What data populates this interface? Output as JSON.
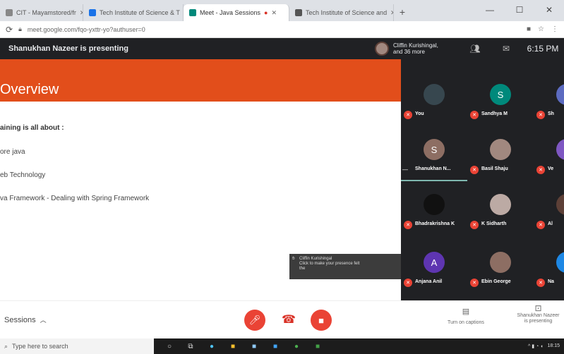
{
  "browser": {
    "tabs": [
      {
        "label": "CIT - Mayamstored/fr",
        "color": "#888",
        "active": false
      },
      {
        "label": "Tech Institute of Science & T",
        "color": "#1a73e8",
        "active": false
      },
      {
        "label": "Meet - Java Sessions",
        "color": "#00897b",
        "active": true
      },
      {
        "label": "Tech Institute of Science and",
        "color": "#555",
        "active": false
      }
    ],
    "address": "meet.google.com/fqo-yxttr-yo?authuser=0",
    "window_controls": [
      "—",
      "☐",
      "✕"
    ]
  },
  "meet": {
    "presenting_text": "Shanukhan Nazeer is presenting",
    "others_text_line1": "Cliffin Kurishingal,",
    "others_text_line2": "and 36 more",
    "clock": "6:15 PM",
    "icons": [
      "people-icon",
      "chat-icon"
    ]
  },
  "slide": {
    "title": "Overview",
    "lines": [
      "aining is all about :",
      "ore java",
      "eb Technology",
      "va Framework - Dealing with Spring Framework"
    ]
  },
  "participants": [
    {
      "name": "You",
      "initial": "",
      "color": "#37474f",
      "speaking": false
    },
    {
      "name": "Sandhya M",
      "initial": "S",
      "color": "#00897b",
      "speaking": false
    },
    {
      "name": "Sh",
      "initial": "",
      "color": "#5c6bc0",
      "speaking": false
    },
    {
      "name": "Shanukhan N...",
      "initial": "S",
      "color": "#8d6e63",
      "speaking": true
    },
    {
      "name": "Basil Shaju",
      "initial": "",
      "color": "#a1887f",
      "speaking": false
    },
    {
      "name": "Ve",
      "initial": "",
      "color": "#7e57c2",
      "speaking": false
    },
    {
      "name": "Bhadrakrishna K",
      "initial": "",
      "color": "#111111",
      "speaking": false
    },
    {
      "name": "K Sidharth",
      "initial": "",
      "color": "#bcaaa4",
      "speaking": false
    },
    {
      "name": "Al",
      "initial": "",
      "color": "#5d4037",
      "speaking": false
    },
    {
      "name": "Anjana Anil",
      "initial": "A",
      "color": "#5e35b1",
      "speaking": false
    },
    {
      "name": "Ebin George",
      "initial": "",
      "color": "#8d6e63",
      "speaking": false
    },
    {
      "name": "Na",
      "initial": "",
      "color": "#1e88e5",
      "speaking": false
    }
  ],
  "tooltip": {
    "line1": "Cliffin Kurishingal",
    "line2": "Click to make your presence felt",
    "line3": "the"
  },
  "controls": {
    "details_label": "Sessions",
    "captions_label": "Turn on captions",
    "presenting_line1": "Shanukhan Nazeer",
    "presenting_line2": "is presenting"
  },
  "taskbar": {
    "search_placeholder": "Type here to search",
    "time": "18:15"
  },
  "colors": {
    "slide_banner": "#e24e1b",
    "meet_dark": "#202124",
    "danger_red": "#ea4335"
  }
}
